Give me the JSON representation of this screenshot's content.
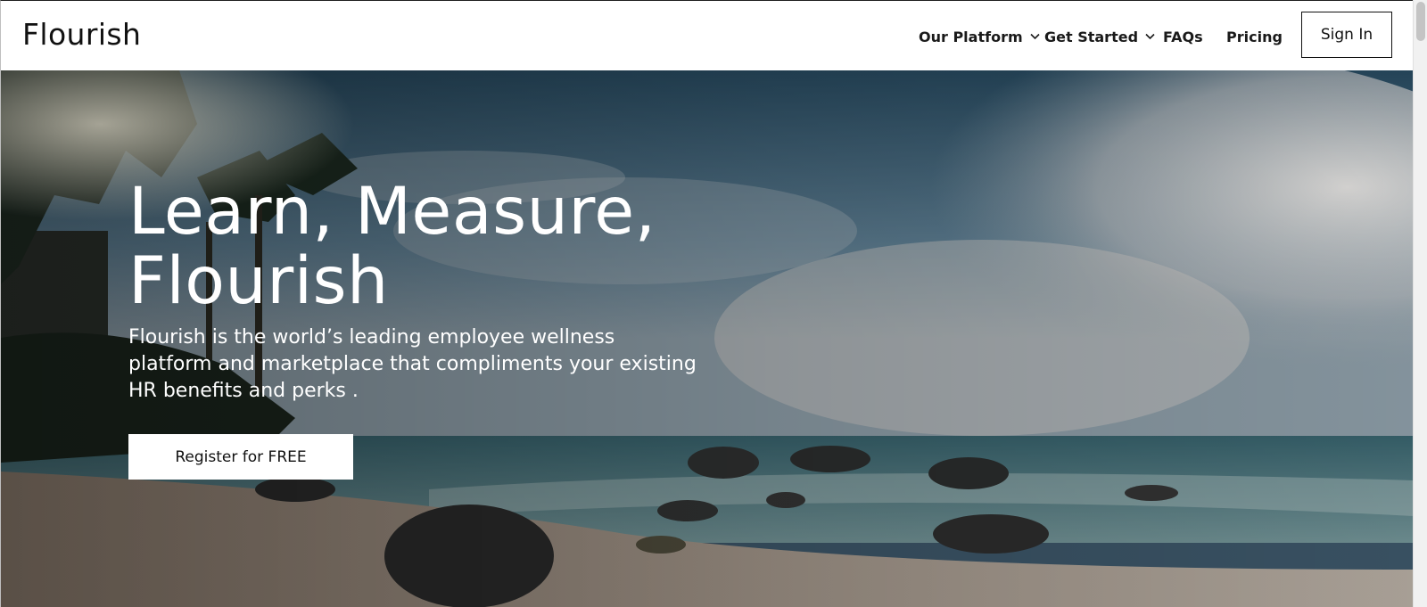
{
  "brand": {
    "logo_text": "Flourish"
  },
  "nav": {
    "items": [
      {
        "label": "Our Platform",
        "has_dropdown": true
      },
      {
        "label": "Get Started",
        "has_dropdown": true
      },
      {
        "label": "FAQs",
        "has_dropdown": false
      },
      {
        "label": "Pricing",
        "has_dropdown": false
      }
    ],
    "sign_in_label": "Sign In"
  },
  "hero": {
    "headline_line1": "Learn, Measure,",
    "headline_line2": "Flourish",
    "description": "Flourish is the world’s leading employee wellness platform and marketplace that compliments your existing HR benefits and perks .",
    "cta_label": "Register for FREE",
    "background": "tropical beach with palm trees, rocks, ocean and cloudy sky"
  },
  "icons": {
    "dropdown": "chevron-down-icon"
  },
  "colors": {
    "header_bg": "#ffffff",
    "text_dark": "#111111",
    "hero_text": "#ffffff",
    "button_bg": "#ffffff"
  }
}
